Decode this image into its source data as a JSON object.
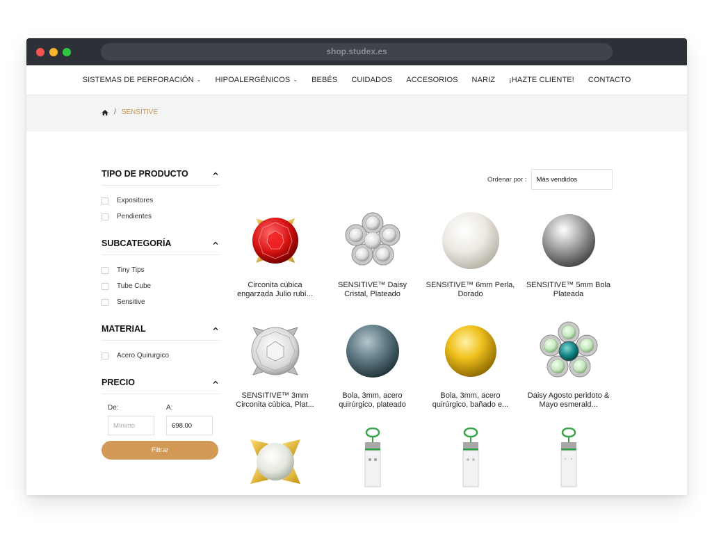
{
  "browser": {
    "url": "shop.studex.es"
  },
  "nav": {
    "items": [
      {
        "label": "SISTEMAS DE PERFORACIÓN",
        "dropdown": true
      },
      {
        "label": "HIPOALERGÉNICOS",
        "dropdown": true
      },
      {
        "label": "BEBÉS",
        "dropdown": false
      },
      {
        "label": "CUIDADOS",
        "dropdown": false
      },
      {
        "label": "ACCESORIOS",
        "dropdown": false
      },
      {
        "label": "NARIZ",
        "dropdown": false
      },
      {
        "label": "¡HAZTE CLIENTE!",
        "dropdown": false
      },
      {
        "label": "CONTACTO",
        "dropdown": false
      }
    ]
  },
  "breadcrumb": {
    "home_icon": "home-icon",
    "separator": "/",
    "current": "SENSITIVE"
  },
  "filters": {
    "tipo": {
      "title": "TIPO DE PRODUCTO",
      "options": [
        "Expositores",
        "Pendientes"
      ]
    },
    "subcategoria": {
      "title": "SUBCATEGORÍA",
      "options": [
        "Tiny Tips",
        "Tube Cube",
        "Sensitive"
      ]
    },
    "material": {
      "title": "MATERIAL",
      "options": [
        "Acero Quirurgico"
      ]
    },
    "precio": {
      "title": "PRECIO",
      "from_label": "De:",
      "to_label": "A:",
      "from_placeholder": "Mínimo",
      "to_value": "698.00",
      "button": "Filtrar"
    }
  },
  "sort": {
    "label": "Ordenar por :",
    "selected": "Más vendidos"
  },
  "products": [
    {
      "name_line1": "Circonita cúbica",
      "name_line2": "engarzada Julio rubí...",
      "icon": "red-crystal-stud"
    },
    {
      "name_line1": "SENSITIVE™ Daisy",
      "name_line2": "Cristal, Plateado",
      "icon": "daisy-crystal-stud"
    },
    {
      "name_line1": "SENSITIVE™ 6mm Perla,",
      "name_line2": "Dorado",
      "icon": "pearl-stud"
    },
    {
      "name_line1": "SENSITIVE™ 5mm Bola",
      "name_line2": "Plateada",
      "icon": "silver-ball-stud"
    },
    {
      "name_line1": "SENSITIVE™ 3mm",
      "name_line2": "Circonita cúbica, Plat...",
      "icon": "clear-crystal-stud"
    },
    {
      "name_line1": "Bola, 3mm, acero",
      "name_line2": "quirúrgico, plateado",
      "icon": "steel-ball-stud"
    },
    {
      "name_line1": "Bola, 3mm, acero",
      "name_line2": "quirúrgico, bañado e...",
      "icon": "gold-ball-stud"
    },
    {
      "name_line1": "Daisy Agosto peridoto &",
      "name_line2": "Mayo esmerald...",
      "icon": "daisy-peridot-stud"
    },
    {
      "name_line1": "",
      "name_line2": "",
      "icon": "gold-pearl-stud"
    },
    {
      "name_line1": "",
      "name_line2": "",
      "icon": "tube-cube"
    },
    {
      "name_line1": "",
      "name_line2": "",
      "icon": "tube-cube"
    },
    {
      "name_line1": "",
      "name_line2": "",
      "icon": "tube-cube"
    }
  ],
  "colors": {
    "accent": "#c9944d",
    "button": "#d29a56",
    "titlebar": "#2e3038"
  }
}
